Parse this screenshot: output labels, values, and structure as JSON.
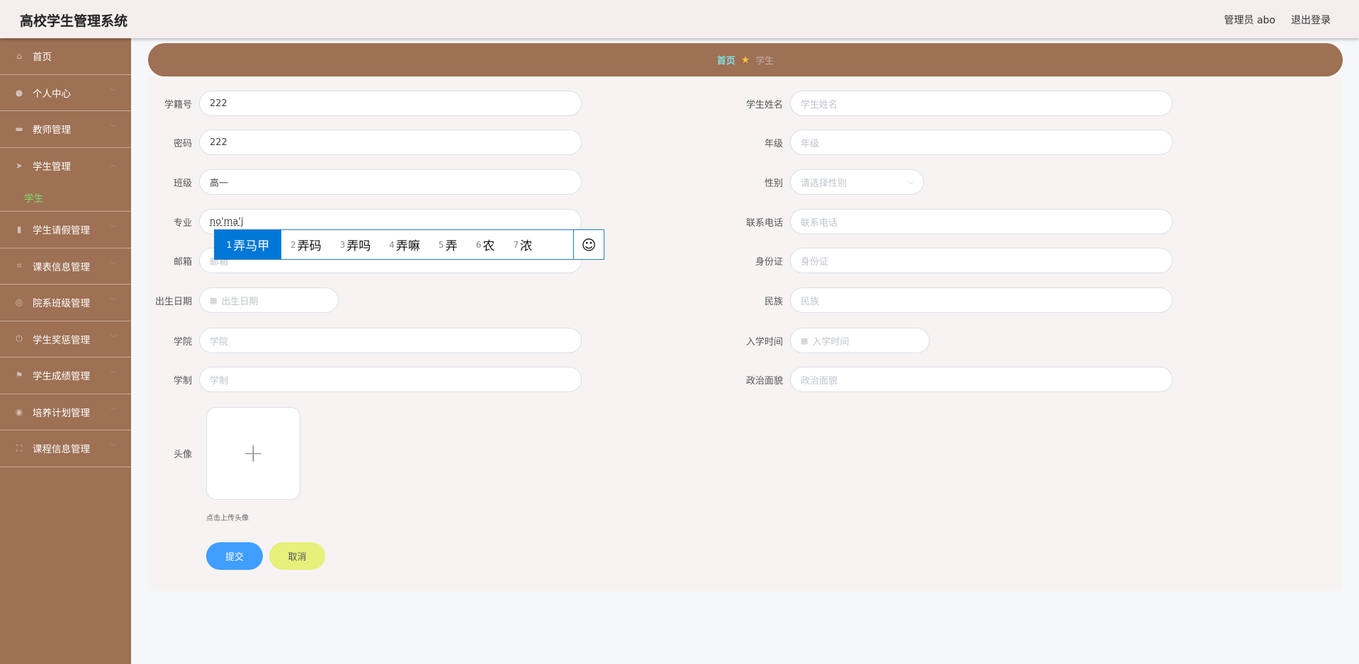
{
  "header": {
    "title": "高校学生管理系统",
    "user": "管理员 abo",
    "logout": "退出登录"
  },
  "sidebar": {
    "items": [
      {
        "label": "首页",
        "icon": "home-icon",
        "sym": "⌂"
      },
      {
        "label": "个人中心",
        "icon": "user-icon",
        "sym": "●"
      },
      {
        "label": "教师管理",
        "icon": "briefcase-icon",
        "sym": "▬"
      },
      {
        "label": "学生管理",
        "icon": "send-icon",
        "sym": "➤",
        "sub": "学生"
      },
      {
        "label": "学生请假管理",
        "icon": "chart-icon",
        "sym": "▮"
      },
      {
        "label": "课表信息管理",
        "icon": "crop-icon",
        "sym": "⌗"
      },
      {
        "label": "院系班级管理",
        "icon": "target-icon",
        "sym": "◎"
      },
      {
        "label": "学生奖惩管理",
        "icon": "power-icon",
        "sym": "⏻"
      },
      {
        "label": "学生成绩管理",
        "icon": "flag-icon",
        "sym": "⚑"
      },
      {
        "label": "培养计划管理",
        "icon": "globe-icon",
        "sym": "◉"
      },
      {
        "label": "课程信息管理",
        "icon": "fullscreen-icon",
        "sym": "⛶"
      }
    ]
  },
  "breadcrumb": {
    "home": "首页",
    "current": "学生"
  },
  "form": {
    "xuejihao": {
      "label": "学籍号",
      "value": "222"
    },
    "mima": {
      "label": "密码",
      "value": "222"
    },
    "banji": {
      "label": "班级",
      "value": "高一"
    },
    "zhuanye": {
      "label": "专业",
      "value": "no'ma'j"
    },
    "youxiang": {
      "label": "邮箱",
      "placeholder": "邮箱"
    },
    "chusheng": {
      "label": "出生日期",
      "placeholder": "出生日期"
    },
    "xueyuan": {
      "label": "学院",
      "placeholder": "学院"
    },
    "xuezhi": {
      "label": "学制",
      "placeholder": "学制"
    },
    "xingming": {
      "label": "学生姓名",
      "placeholder": "学生姓名"
    },
    "nianji": {
      "label": "年级",
      "placeholder": "年级"
    },
    "xingbie": {
      "label": "性别",
      "placeholder": "请选择性别"
    },
    "dianhua": {
      "label": "联系电话",
      "placeholder": "联系电话"
    },
    "shenfenzheng": {
      "label": "身份证",
      "placeholder": "身份证"
    },
    "minzu": {
      "label": "民族",
      "placeholder": "民族"
    },
    "ruxue": {
      "label": "入学时间",
      "placeholder": "入学时间"
    },
    "zhengzhi": {
      "label": "政治面貌",
      "placeholder": "政治面貌"
    },
    "touxiang": {
      "label": "头像",
      "hint": "点击上传头像"
    },
    "submit": "提交",
    "cancel": "取消"
  },
  "ime": {
    "candidates": [
      {
        "n": "1",
        "t": "弄马甲"
      },
      {
        "n": "2",
        "t": "弄码"
      },
      {
        "n": "3",
        "t": "弄吗"
      },
      {
        "n": "4",
        "t": "弄嘛"
      },
      {
        "n": "5",
        "t": "弄"
      },
      {
        "n": "6",
        "t": "农"
      },
      {
        "n": "7",
        "t": "浓"
      }
    ]
  }
}
